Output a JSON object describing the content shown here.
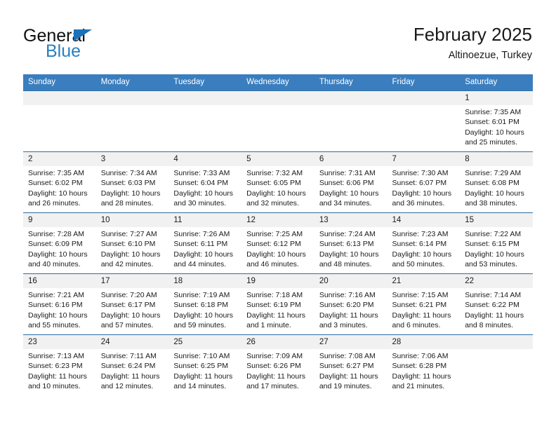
{
  "brand": {
    "name_part1": "General",
    "name_part2": "Blue",
    "accent_color": "#2a7fc0",
    "triangle_color": "#1b72b8"
  },
  "header": {
    "title": "February 2025",
    "subtitle": "Altinoezue, Turkey"
  },
  "theme": {
    "header_row_bg": "#3a7ebf",
    "row_divider": "#2e6da4",
    "daynum_bg": "#f1f1f1"
  },
  "weekday_headers": [
    "Sunday",
    "Monday",
    "Tuesday",
    "Wednesday",
    "Thursday",
    "Friday",
    "Saturday"
  ],
  "weeks": [
    [
      {
        "day": "",
        "lines": []
      },
      {
        "day": "",
        "lines": []
      },
      {
        "day": "",
        "lines": []
      },
      {
        "day": "",
        "lines": []
      },
      {
        "day": "",
        "lines": []
      },
      {
        "day": "",
        "lines": []
      },
      {
        "day": "1",
        "lines": [
          "Sunrise: 7:35 AM",
          "Sunset: 6:01 PM",
          "Daylight: 10 hours",
          "and 25 minutes."
        ]
      }
    ],
    [
      {
        "day": "2",
        "lines": [
          "Sunrise: 7:35 AM",
          "Sunset: 6:02 PM",
          "Daylight: 10 hours",
          "and 26 minutes."
        ]
      },
      {
        "day": "3",
        "lines": [
          "Sunrise: 7:34 AM",
          "Sunset: 6:03 PM",
          "Daylight: 10 hours",
          "and 28 minutes."
        ]
      },
      {
        "day": "4",
        "lines": [
          "Sunrise: 7:33 AM",
          "Sunset: 6:04 PM",
          "Daylight: 10 hours",
          "and 30 minutes."
        ]
      },
      {
        "day": "5",
        "lines": [
          "Sunrise: 7:32 AM",
          "Sunset: 6:05 PM",
          "Daylight: 10 hours",
          "and 32 minutes."
        ]
      },
      {
        "day": "6",
        "lines": [
          "Sunrise: 7:31 AM",
          "Sunset: 6:06 PM",
          "Daylight: 10 hours",
          "and 34 minutes."
        ]
      },
      {
        "day": "7",
        "lines": [
          "Sunrise: 7:30 AM",
          "Sunset: 6:07 PM",
          "Daylight: 10 hours",
          "and 36 minutes."
        ]
      },
      {
        "day": "8",
        "lines": [
          "Sunrise: 7:29 AM",
          "Sunset: 6:08 PM",
          "Daylight: 10 hours",
          "and 38 minutes."
        ]
      }
    ],
    [
      {
        "day": "9",
        "lines": [
          "Sunrise: 7:28 AM",
          "Sunset: 6:09 PM",
          "Daylight: 10 hours",
          "and 40 minutes."
        ]
      },
      {
        "day": "10",
        "lines": [
          "Sunrise: 7:27 AM",
          "Sunset: 6:10 PM",
          "Daylight: 10 hours",
          "and 42 minutes."
        ]
      },
      {
        "day": "11",
        "lines": [
          "Sunrise: 7:26 AM",
          "Sunset: 6:11 PM",
          "Daylight: 10 hours",
          "and 44 minutes."
        ]
      },
      {
        "day": "12",
        "lines": [
          "Sunrise: 7:25 AM",
          "Sunset: 6:12 PM",
          "Daylight: 10 hours",
          "and 46 minutes."
        ]
      },
      {
        "day": "13",
        "lines": [
          "Sunrise: 7:24 AM",
          "Sunset: 6:13 PM",
          "Daylight: 10 hours",
          "and 48 minutes."
        ]
      },
      {
        "day": "14",
        "lines": [
          "Sunrise: 7:23 AM",
          "Sunset: 6:14 PM",
          "Daylight: 10 hours",
          "and 50 minutes."
        ]
      },
      {
        "day": "15",
        "lines": [
          "Sunrise: 7:22 AM",
          "Sunset: 6:15 PM",
          "Daylight: 10 hours",
          "and 53 minutes."
        ]
      }
    ],
    [
      {
        "day": "16",
        "lines": [
          "Sunrise: 7:21 AM",
          "Sunset: 6:16 PM",
          "Daylight: 10 hours",
          "and 55 minutes."
        ]
      },
      {
        "day": "17",
        "lines": [
          "Sunrise: 7:20 AM",
          "Sunset: 6:17 PM",
          "Daylight: 10 hours",
          "and 57 minutes."
        ]
      },
      {
        "day": "18",
        "lines": [
          "Sunrise: 7:19 AM",
          "Sunset: 6:18 PM",
          "Daylight: 10 hours",
          "and 59 minutes."
        ]
      },
      {
        "day": "19",
        "lines": [
          "Sunrise: 7:18 AM",
          "Sunset: 6:19 PM",
          "Daylight: 11 hours",
          "and 1 minute."
        ]
      },
      {
        "day": "20",
        "lines": [
          "Sunrise: 7:16 AM",
          "Sunset: 6:20 PM",
          "Daylight: 11 hours",
          "and 3 minutes."
        ]
      },
      {
        "day": "21",
        "lines": [
          "Sunrise: 7:15 AM",
          "Sunset: 6:21 PM",
          "Daylight: 11 hours",
          "and 6 minutes."
        ]
      },
      {
        "day": "22",
        "lines": [
          "Sunrise: 7:14 AM",
          "Sunset: 6:22 PM",
          "Daylight: 11 hours",
          "and 8 minutes."
        ]
      }
    ],
    [
      {
        "day": "23",
        "lines": [
          "Sunrise: 7:13 AM",
          "Sunset: 6:23 PM",
          "Daylight: 11 hours",
          "and 10 minutes."
        ]
      },
      {
        "day": "24",
        "lines": [
          "Sunrise: 7:11 AM",
          "Sunset: 6:24 PM",
          "Daylight: 11 hours",
          "and 12 minutes."
        ]
      },
      {
        "day": "25",
        "lines": [
          "Sunrise: 7:10 AM",
          "Sunset: 6:25 PM",
          "Daylight: 11 hours",
          "and 14 minutes."
        ]
      },
      {
        "day": "26",
        "lines": [
          "Sunrise: 7:09 AM",
          "Sunset: 6:26 PM",
          "Daylight: 11 hours",
          "and 17 minutes."
        ]
      },
      {
        "day": "27",
        "lines": [
          "Sunrise: 7:08 AM",
          "Sunset: 6:27 PM",
          "Daylight: 11 hours",
          "and 19 minutes."
        ]
      },
      {
        "day": "28",
        "lines": [
          "Sunrise: 7:06 AM",
          "Sunset: 6:28 PM",
          "Daylight: 11 hours",
          "and 21 minutes."
        ]
      },
      {
        "day": "",
        "lines": []
      }
    ]
  ]
}
